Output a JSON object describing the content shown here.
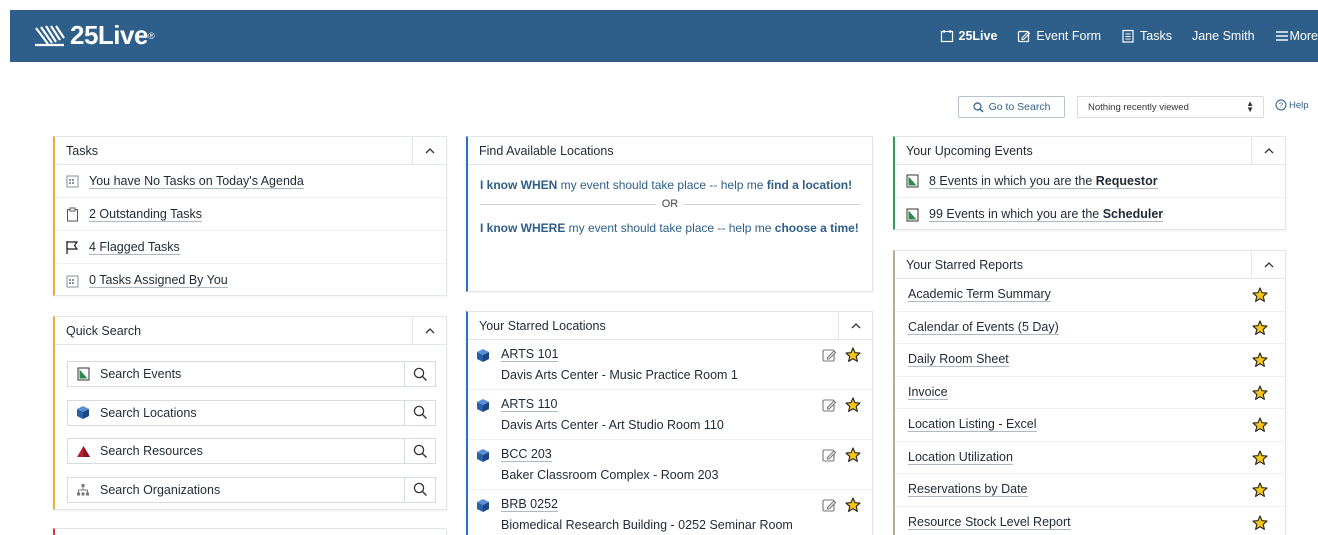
{
  "header": {
    "brand": "25Live",
    "nav": {
      "home_label": "25Live",
      "event_form_label": "Event Form",
      "tasks_label": "Tasks",
      "user_label": "Jane Smith",
      "more_label": "More"
    },
    "color": "#2e5f8a"
  },
  "toolbar": {
    "go_to_search_label": "Go to Search",
    "recently_viewed_value": "Nothing recently viewed",
    "help_label": "Help"
  },
  "tasks": {
    "title": "Tasks",
    "items": [
      {
        "label": "You have No Tasks on Today's Agenda",
        "icon": "calendar-icon"
      },
      {
        "label": "2 Outstanding Tasks",
        "icon": "clipboard-icon"
      },
      {
        "label": "4 Flagged Tasks",
        "icon": "flag-icon"
      },
      {
        "label": "0 Tasks Assigned By You",
        "icon": "calendar-icon"
      }
    ]
  },
  "quick_search": {
    "title": "Quick Search",
    "items": [
      {
        "label": "Search Events",
        "icon": "event-icon"
      },
      {
        "label": "Search Locations",
        "icon": "location-cube-icon"
      },
      {
        "label": "Search Resources",
        "icon": "resource-icon"
      },
      {
        "label": "Search Organizations",
        "icon": "organization-icon"
      }
    ]
  },
  "find_locations": {
    "title": "Find Available Locations",
    "when_bold": "I know WHEN",
    "when_mid": " my event should take place -- help me ",
    "when_link": "find a location!",
    "or_label": "OR",
    "where_bold": "I know WHERE",
    "where_mid": " my event should take place -- help me ",
    "where_link": "choose a time!"
  },
  "starred_locations": {
    "title": "Your Starred Locations",
    "items": [
      {
        "code": "ARTS 101",
        "desc": "Davis Arts Center - Music Practice Room 1"
      },
      {
        "code": "ARTS 110",
        "desc": "Davis Arts Center - Art Studio Room 110"
      },
      {
        "code": "BCC 203",
        "desc": "Baker Classroom Complex - Room 203"
      },
      {
        "code": "BRB 0252",
        "desc": "Biomedical Research Building - 0252 Seminar Room"
      }
    ]
  },
  "upcoming_events": {
    "title": "Your Upcoming Events",
    "items": [
      {
        "prefix": "8 Events in which you are the ",
        "role": "Requestor"
      },
      {
        "prefix": "99 Events in which you are the ",
        "role": "Scheduler"
      }
    ]
  },
  "starred_reports": {
    "title": "Your Starred Reports",
    "items": [
      "Academic Term Summary",
      "Calendar of Events (5 Day)",
      "Daily Room Sheet",
      "Invoice",
      "Location Listing - Excel",
      "Location Utilization",
      "Reservations by Date",
      "Resource Stock Level Report"
    ]
  },
  "colors": {
    "star": "#f5c518",
    "accent_orange": "#f2a93b",
    "accent_blue": "#2e6fbf",
    "accent_green": "#2f9c58"
  }
}
